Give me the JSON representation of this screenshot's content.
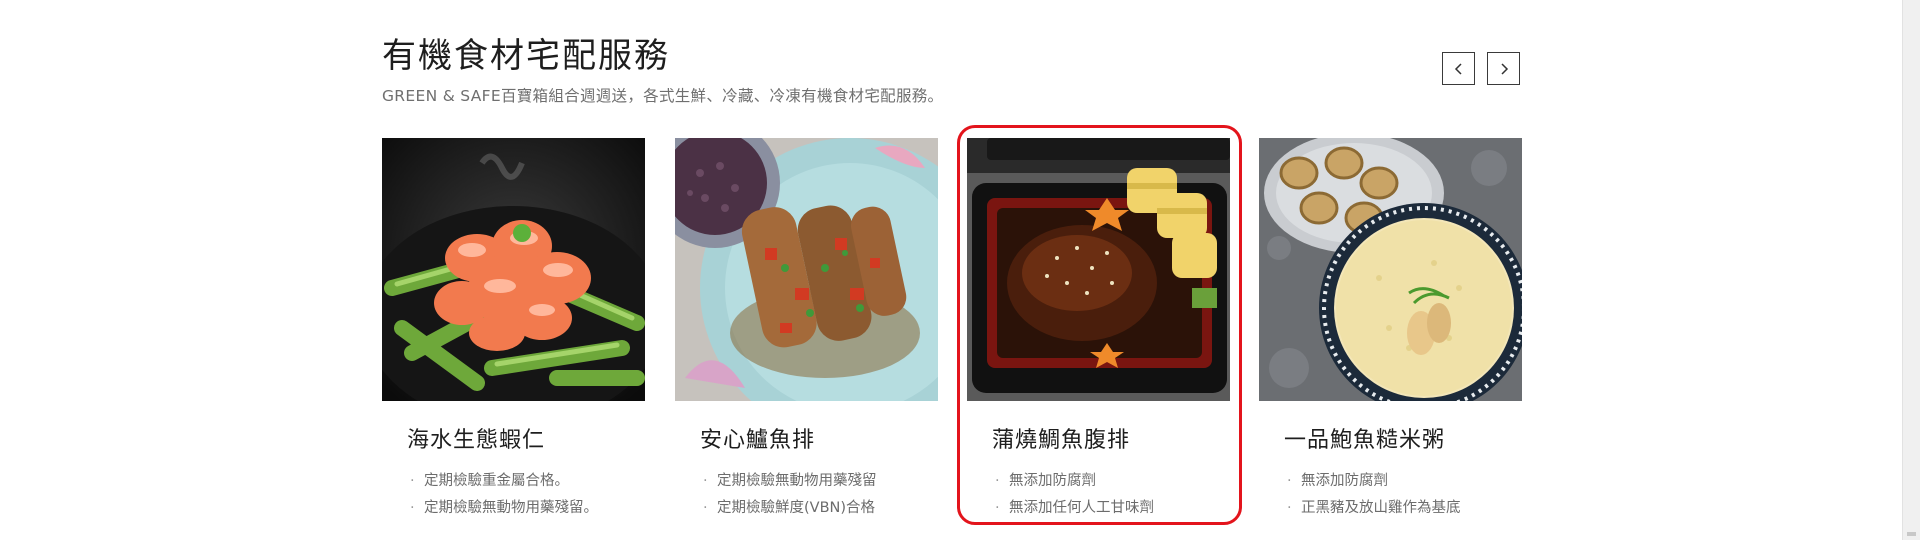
{
  "section": {
    "title": "有機食材宅配服務",
    "subtitle": "GREEN & SAFE百寶箱組合週週送，各式生鮮、冷藏、冷凍有機食材宅配服務。"
  },
  "nav": {
    "prev_icon": "chevron-left-icon",
    "next_icon": "chevron-right-icon"
  },
  "products": [
    {
      "name": "海水生態蝦仁",
      "image": "shrimp-asparagus-photo",
      "features": [
        "定期檢驗重金屬合格。",
        "定期檢驗無動物用藥殘留。"
      ]
    },
    {
      "name": "安心鱸魚排",
      "image": "sea-bass-fillet-photo",
      "features": [
        "定期檢驗無動物用藥殘留",
        "定期檢驗鮮度(VBN)合格"
      ]
    },
    {
      "name": "蒲燒鯛魚腹排",
      "image": "kabayaki-sea-bream-bento-photo",
      "features": [
        "無添加防腐劑",
        "無添加任何人工甘味劑"
      ]
    },
    {
      "name": "一品鮑魚糙米粥",
      "image": "abalone-brown-rice-porridge-photo",
      "features": [
        "無添加防腐劑",
        "正黑豬及放山雞作為基底"
      ]
    }
  ],
  "colors": {
    "highlight": "#e3141c",
    "title": "#1e1e1e",
    "muted": "#6c6c6c"
  }
}
